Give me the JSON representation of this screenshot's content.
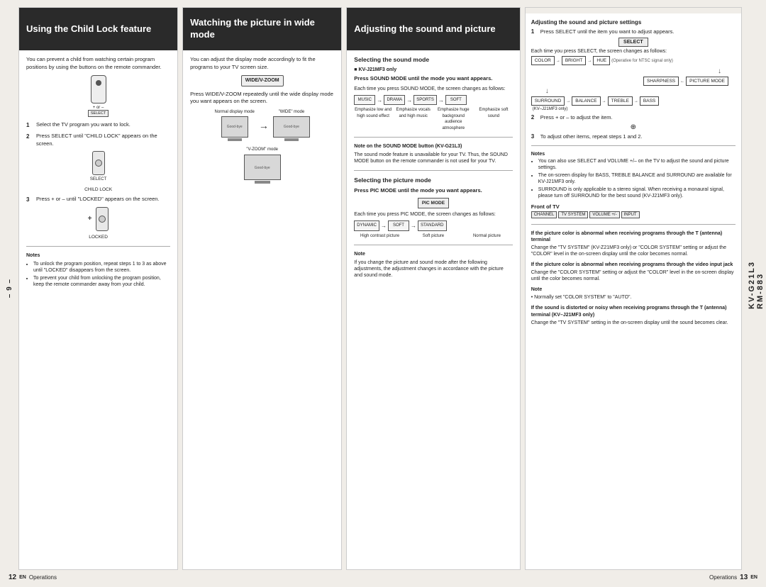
{
  "page": {
    "background": "#f0ede8"
  },
  "columns": [
    {
      "id": "col1",
      "header": "Using the Child Lock feature",
      "body": {
        "intro": "You can prevent a child from watching certain program positions by using the buttons on the remote commander.",
        "steps": [
          {
            "num": "1",
            "text": "Select the TV program you want to lock."
          },
          {
            "num": "2",
            "text": "Press SELECT until \"CHILD LOCK\" appears on the screen."
          },
          {
            "num": "3",
            "text": "Press + or – until \"LOCKED\" appears on the screen."
          }
        ],
        "child_lock_label": "CHILD LOCK",
        "locked_label": "LOCKED",
        "select_label": "SELECT",
        "notes_title": "Notes",
        "notes": [
          "To unlock the program position, repeat steps 1 to 3 as above until \"LOCKED\" disappears from the screen.",
          "To prevent your child from unlocking the program position, keep the remote commander away from your child."
        ]
      }
    },
    {
      "id": "col2",
      "header": "Watching the picture in wide mode",
      "body": {
        "intro": "You can adjust the display mode accordingly to fit the programs to your TV screen size.",
        "instruction": "Press WIDE/V-ZOOM repeatedly until the wide display mode you want appears on the screen.",
        "normal_label": "Normal display mode",
        "wide_label": "\"WIDE\" mode",
        "vzoom_label": "\"V-ZOOM\" mode",
        "wide_btn": "WIDE/V-ZOOM",
        "sony_label": "Good-bye"
      }
    },
    {
      "id": "col3",
      "header": "Adjusting the sound and picture",
      "body": {
        "sound_section_title": "Selecting the sound mode",
        "sound_note_label": "■ KV-J21MF3 only",
        "sound_instruction": "Press SOUND MODE until the mode you want appears.",
        "sound_each": "Each time you press SOUND MODE, the screen changes as follows:",
        "sound_modes": [
          "MUSIC",
          "DRAMA",
          "SPORTS",
          "SOFT"
        ],
        "sound_mode_labels": [
          "Emphasize low and high sound effect",
          "Emphasize vocals and high music",
          "Emphasize huge background audience atmosphere",
          "Emphasize soft sound"
        ],
        "sound_note_title": "Note on the SOUND MODE button (KV-G21L3)",
        "sound_note_text": "The sound mode feature is unavailable for your TV. Thus, the SOUND MODE button on the remote commander is not used for your TV.",
        "pic_section_title": "Selecting the picture mode",
        "pic_instruction": "Press PIC MODE until the mode you want appears.",
        "pic_each": "Each time you press PIC MODE, the screen changes as follows:",
        "pic_modes": [
          "DYNAMIC",
          "SOFT",
          "STANDARD"
        ],
        "pic_mode_labels": [
          "High contrast picture",
          "Soft picture",
          "Normal picture"
        ],
        "pic_note_title": "Note",
        "pic_note_text": "If you change the picture and sound mode after the following adjustments, the adjustment changes in accordance with the picture and sound mode."
      }
    },
    {
      "id": "col4",
      "header": null,
      "body": {
        "main_title": "Adjusting the sound and picture settings",
        "step1_title": "1",
        "step1_text": "Press SELECT until the item you want to adjust appears.",
        "step1_select": "SELECT",
        "step1_each": "Each time you press SELECT, the screen changes as follows:",
        "chain_items": [
          "COLOR",
          "BRIGHT",
          "HUE",
          "SHARPNESS"
        ],
        "chain_note": "(Operative for NTSC signal only)",
        "chain2_items": [
          "PICTURE MODE",
          "SHARPNESS"
        ],
        "chain3_items": [
          "SURROUND",
          "BALANCE",
          "TREBLE",
          "BASS"
        ],
        "kv_note1": "(KV–J21MF3 only)",
        "step2_title": "2",
        "step2_text": "Press + or – to adjust the item.",
        "step3_title": "3",
        "step3_text": "To adjust other items, repeat steps 1 and 2.",
        "notes_title": "Notes",
        "notes": [
          "You can also use SELECT and VOLUME +/– on the TV to adjust the sound and picture settings.",
          "The on-screen display for BASS, TREBLE BALANCE and SURROUND are available for KV-J21MF3 only.",
          "SURROUND is only applicable to a stereo signal. When receiving a monaural signal, please turn off SURROUND for the best sound (KV-J21MF3 only)."
        ],
        "front_tv_label": "Front of TV",
        "front_tv_btns": [
          "CHANNEL",
          "TV SYSTEM",
          "VOLUME +/-",
          "INPUT"
        ],
        "antenna_title": "If the picture color is abnormal when receiving programs through the T (antenna) terminal",
        "antenna_text": "Change the \"TV SYSTEM\" (KV-Z21MF3 only) or \"COLOR SYSTEM\" setting or adjust the \"COLOR\" level in the on-screen display until the color becomes normal.",
        "video_title": "If the picture color is abnormal when receiving programs through the video input jack",
        "video_text": "Change the \"COLOR SYSTEM\" setting or adjust the \"COLOR\" level in the on-screen display until the color becomes normal.",
        "note2_title": "Note",
        "note2_text": "• Normally set \"COLOR SYSTEM\" to \"AUTO\".",
        "distorted_title": "If the sound is distorted or noisy when receiving programs through the T (antenna) terminal (KV–J21MF3 only)",
        "distorted_text": "Change the \"TV SYSTEM\" setting in the on-screen display until the sound becomes clear."
      }
    }
  ],
  "footer": {
    "left_num": "12",
    "left_en": "EN",
    "left_label": "Operations",
    "right_num": "13",
    "right_en": "EN",
    "right_label": "Operations",
    "page_indicator": "– 9 –",
    "model": "KV-G21L3",
    "model2": "RM-883"
  }
}
